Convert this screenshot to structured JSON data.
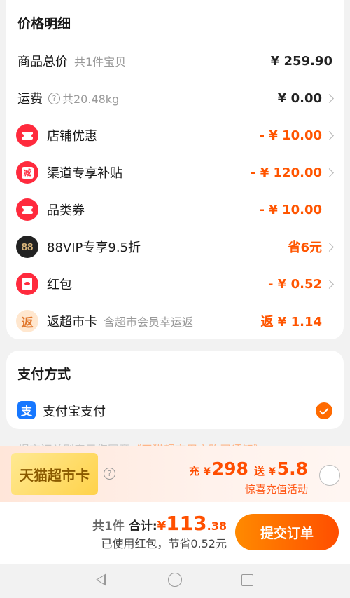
{
  "price_detail": {
    "title": "价格明细",
    "goods_total": {
      "label": "商品总价",
      "sub": "共1件宝贝",
      "value": "¥ 259.90"
    },
    "shipping": {
      "label": "运费",
      "help": "?",
      "sub": "共20.48kg",
      "value": "¥ 0.00"
    },
    "shop_discount": {
      "label": "店铺优惠",
      "value": "- ¥ 10.00",
      "icon": "coupon-icon"
    },
    "channel_subsidy": {
      "label": "渠道专享补贴",
      "value": "- ¥ 120.00",
      "icon": "subsidy-icon",
      "icon_text": "减"
    },
    "category_coupon": {
      "label": "品类券",
      "value": "- ¥ 10.00",
      "icon": "coupon-icon"
    },
    "vip88": {
      "label": "88VIP专享9.5折",
      "value": "省6元",
      "icon": "vip-icon",
      "icon_text": "88"
    },
    "red_packet": {
      "label": "红包",
      "value": "- ¥ 0.52",
      "icon": "red-packet-icon"
    },
    "supermarket_card": {
      "label": "返超市卡",
      "sub": "含超市会员幸运返",
      "value": "返 ¥ 1.14",
      "icon": "cashback-icon",
      "icon_text": "返"
    }
  },
  "payment": {
    "title": "支付方式",
    "method": "支付宝支付",
    "icon_text": "支",
    "selected": true
  },
  "notice": {
    "prefix": "提交订单则表示您同意",
    "link": "《天猫超市用户购买须知》"
  },
  "promo": {
    "card_label": "天猫超市卡",
    "help": "?",
    "recharge_label": "充",
    "recharge_yen": "¥",
    "recharge_amount": "298",
    "bonus_label": "送",
    "bonus_yen": "¥",
    "bonus_amount": "5.8",
    "activity": "惊喜充值活动"
  },
  "summary": {
    "count": "共1件",
    "total_label": "合计:",
    "yen": "¥",
    "total_int": "113",
    "total_dec": ".38",
    "saved": "已使用红包，节省0.52元",
    "submit": "提交订单"
  },
  "colors": {
    "accent": "#ff5500",
    "alipay": "#1677ff",
    "red_icon": "#ff2a3d"
  }
}
